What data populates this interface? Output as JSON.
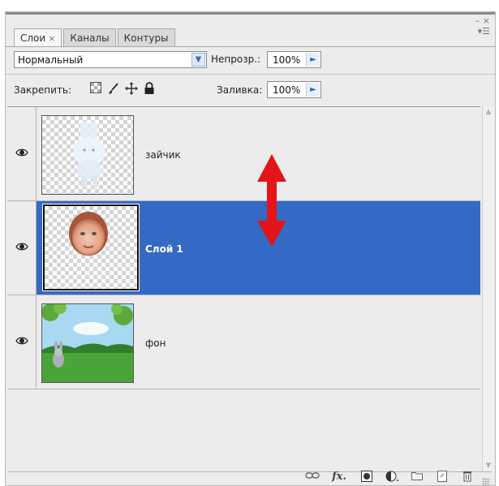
{
  "tabs": [
    {
      "label": "Слои",
      "close": "×"
    },
    {
      "label": "Каналы"
    },
    {
      "label": "Контуры"
    }
  ],
  "panel_controls": {
    "minimize": "– ×",
    "menu": "▾☰"
  },
  "blend_mode": {
    "value": "Нормальный"
  },
  "opacity": {
    "label": "Непрозр.:",
    "value": "100%"
  },
  "lock": {
    "label": "Закрепить:"
  },
  "fill": {
    "label": "Заливка:",
    "value": "100%"
  },
  "layers": [
    {
      "name": "зайчик",
      "visible": true,
      "selected": false
    },
    {
      "name": "Слой 1",
      "visible": true,
      "selected": true
    },
    {
      "name": "фон",
      "visible": true,
      "selected": false
    }
  ],
  "colors": {
    "selection": "#3469c5",
    "arrow": "#e3151a"
  },
  "bottom_icons": [
    "link-icon",
    "fx-icon",
    "mask-icon",
    "adjustment-icon",
    "group-folder-icon",
    "new-layer-icon",
    "trash-icon"
  ]
}
